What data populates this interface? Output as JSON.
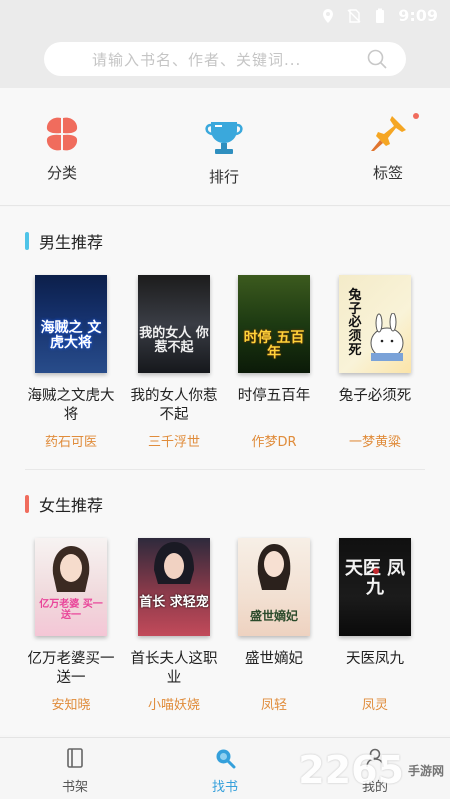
{
  "status_bar": {
    "time": "9:09"
  },
  "search": {
    "placeholder": "请输入书名、作者、关键词..."
  },
  "quick_nav": [
    {
      "label": "分类",
      "icon": "category-icon"
    },
    {
      "label": "排行",
      "icon": "trophy-icon"
    },
    {
      "label": "标签",
      "icon": "pin-icon"
    }
  ],
  "sections": {
    "male": {
      "title": "男生推荐",
      "accent": "#4fc4e8",
      "books": [
        {
          "name": "海贼之文虎大将",
          "author": "药石可医"
        },
        {
          "name": "我的女人你惹不起",
          "author": "三千浮世"
        },
        {
          "name": "时停五百年",
          "author": "作梦DR"
        },
        {
          "name": "兔子必须死",
          "author": "一梦黄粱"
        }
      ]
    },
    "female": {
      "title": "女生推荐",
      "accent": "#f06c5d",
      "books": [
        {
          "name": "亿万老婆买一送一",
          "author": "安知晓"
        },
        {
          "name": "首长夫人这职业",
          "author": "小喵妖娆"
        },
        {
          "name": "盛世嫡妃",
          "author": "凤轻"
        },
        {
          "name": "天医凤九",
          "author": "凤灵"
        }
      ]
    }
  },
  "covers": {
    "c1": "海贼之 文虎大将",
    "c2": "我的女人 你惹不起",
    "c3": "时停 五百年",
    "c4": "兔子 必须 死",
    "c5": "亿万老婆 买一送一",
    "c6": "首长 求轻宠",
    "c7": "盛世嫡妃",
    "c8": "天医 凤九"
  },
  "bottom_nav": [
    {
      "label": "书架",
      "icon": "bookshelf-icon"
    },
    {
      "label": "找书",
      "icon": "find-book-icon",
      "active": true
    },
    {
      "label": "我的",
      "icon": "profile-icon"
    }
  ],
  "watermark": {
    "number": "2265",
    "text": "手游网"
  },
  "colors": {
    "author": "#e08c3b",
    "active_tab": "#35a0db"
  }
}
